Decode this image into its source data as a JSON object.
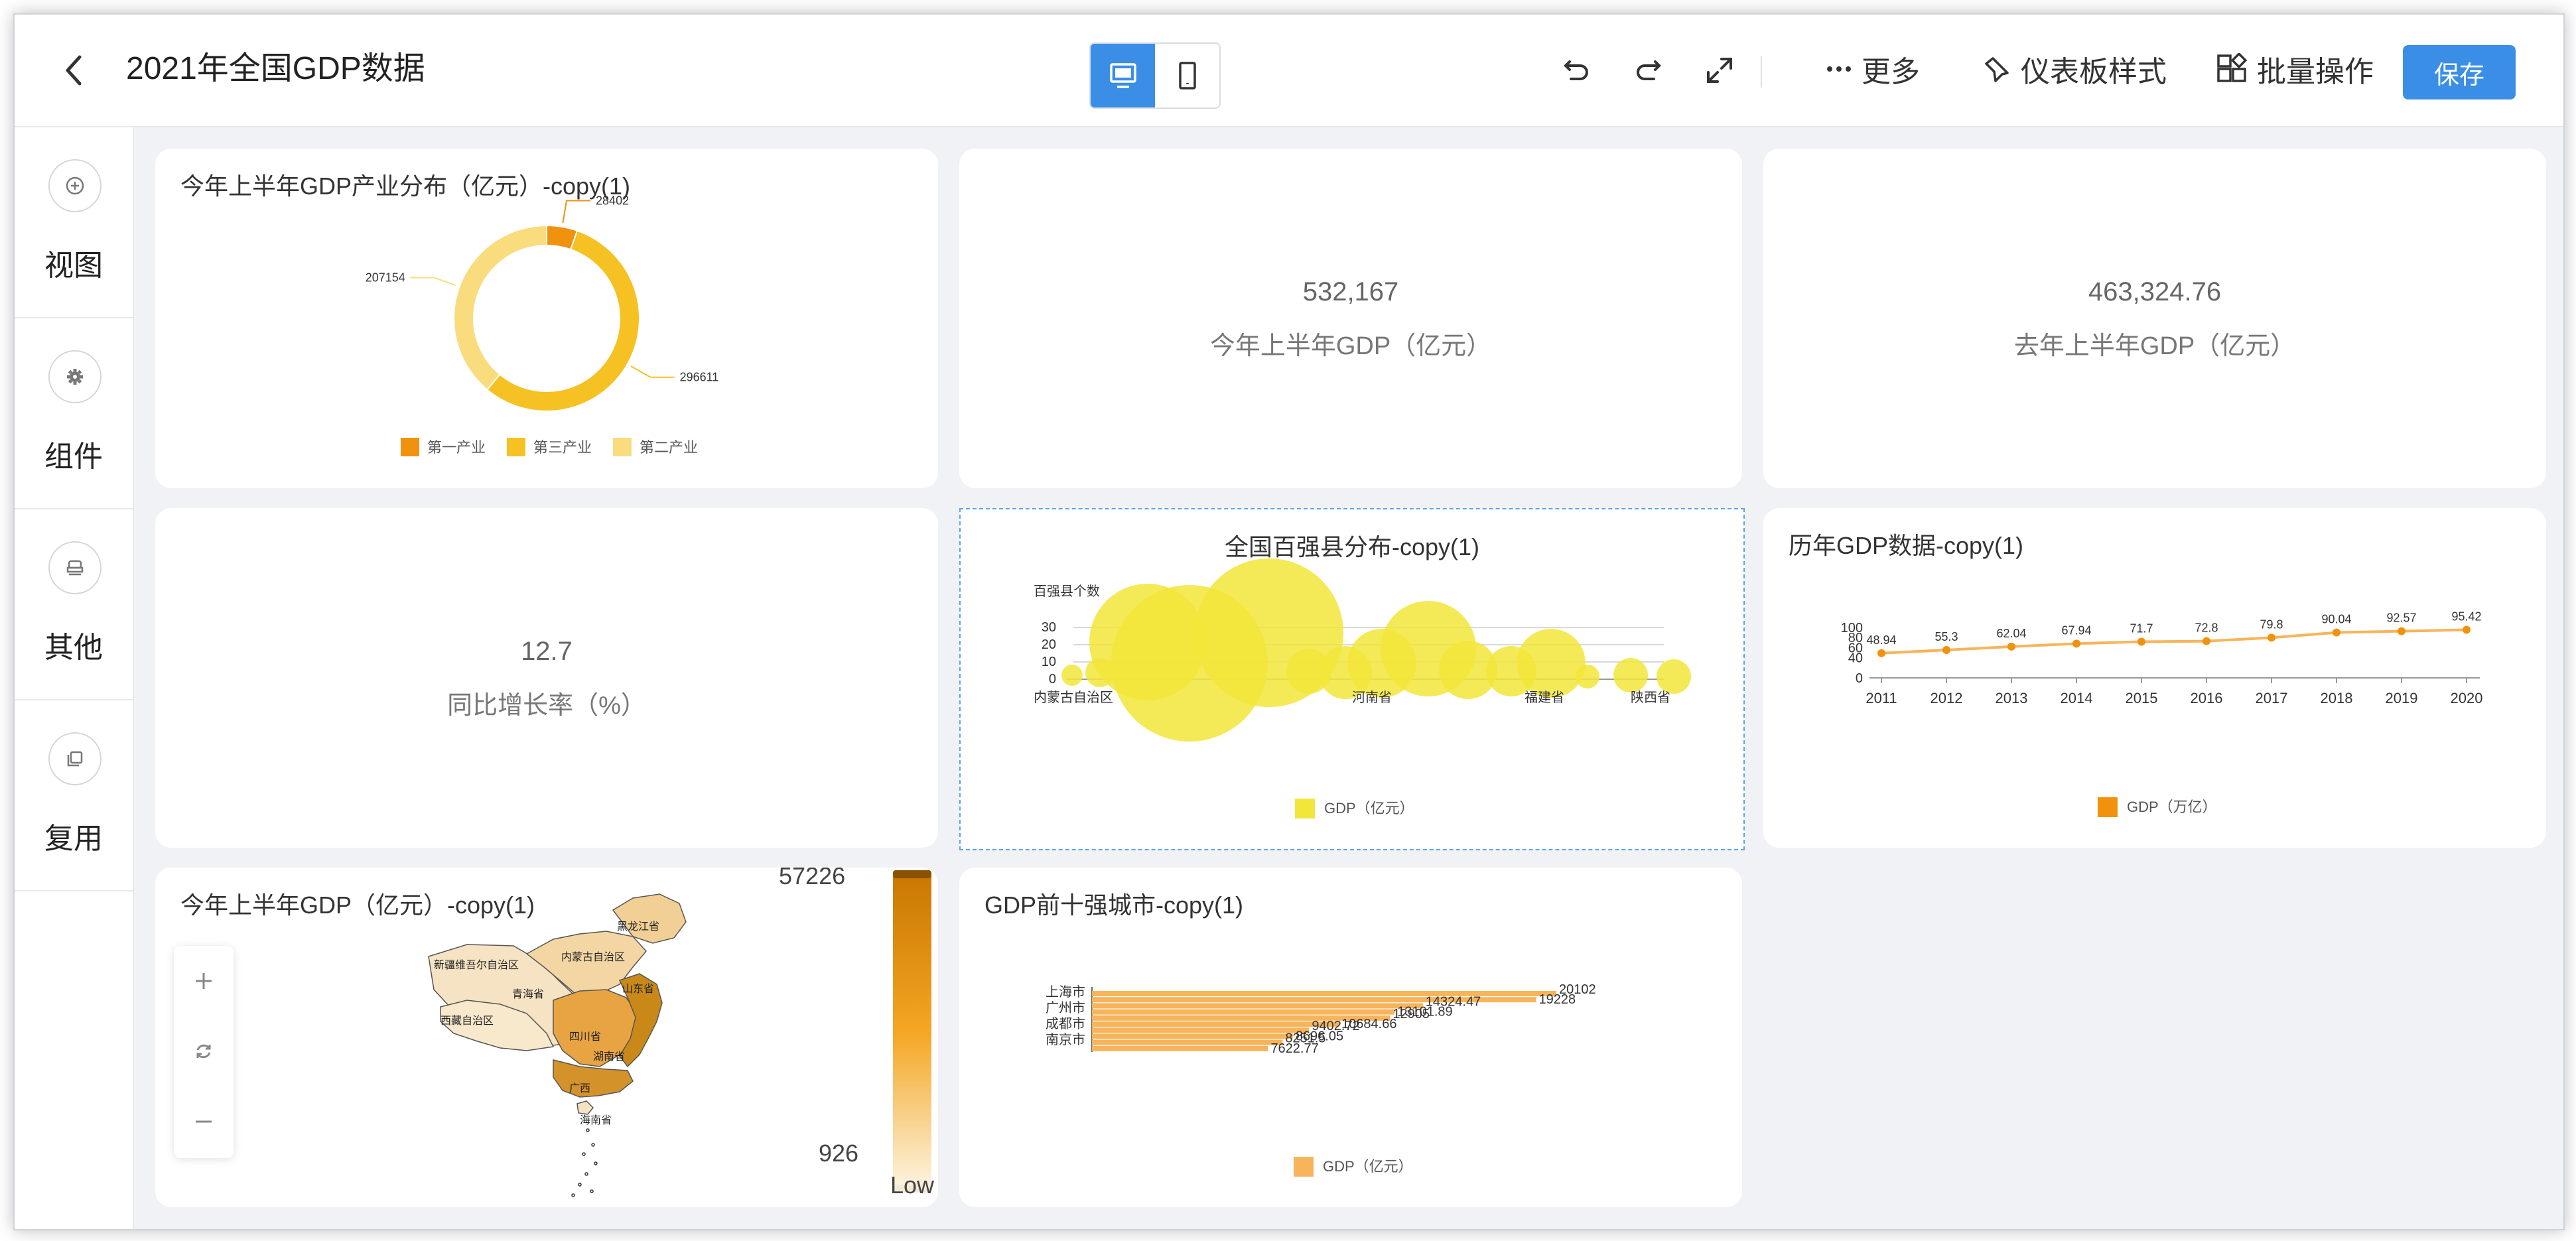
{
  "header": {
    "title": "2021年全国GDP数据",
    "more_label": "更多",
    "style_label": "仪表板样式",
    "batch_label": "批量操作",
    "save_label": "保存"
  },
  "sidebar": {
    "items": [
      {
        "label": "视图",
        "icon": "plus-circle-icon"
      },
      {
        "label": "组件",
        "icon": "gear-icon"
      },
      {
        "label": "其他",
        "icon": "stamp-icon"
      },
      {
        "label": "复用",
        "icon": "copy-icon"
      }
    ]
  },
  "cards": {
    "pie": {
      "title": "今年上半年GDP产业分布（亿元）-copy(1)"
    },
    "kpi1": {
      "value": "532,167",
      "label": "今年上半年GDP（亿元）"
    },
    "kpi2": {
      "value": "463,324.76",
      "label": "去年上半年GDP（亿元）"
    },
    "kpi3": {
      "value": "12.7",
      "label": "同比增长率（%）"
    },
    "bubble": {
      "title": "全国百强县分布-copy(1)"
    },
    "line": {
      "title": "历年GDP数据-copy(1)"
    },
    "map": {
      "title": "今年上半年GDP（亿元）-copy(1)",
      "max": "57226",
      "min": "926",
      "low_label": "Low"
    },
    "bar": {
      "title": "GDP前十强城市-copy(1)"
    }
  },
  "colors": {
    "accent": "#3a8ee6",
    "orange": "#f0920e",
    "yellow": "#f5c123",
    "lightyellow": "#f9dc7e",
    "bubble": "#f2e63a",
    "bar": "#f7b45a"
  },
  "chart_data": [
    {
      "type": "pie",
      "title": "今年上半年GDP产业分布（亿元）-copy(1)",
      "categories": [
        "第一产业",
        "第三产业",
        "第二产业"
      ],
      "values": [
        28402,
        296611,
        207154
      ],
      "colors": [
        "#f0920e",
        "#f5c123",
        "#f9dc7e"
      ],
      "donut": true,
      "legend": "bottom"
    },
    {
      "type": "scatter",
      "title": "全国百强县分布-copy(1)",
      "ylabel": "百强县个数",
      "yticks": [
        0,
        10,
        20,
        30
      ],
      "xlabels": [
        "内蒙古自治区",
        "河南省",
        "福建省",
        "陕西省"
      ],
      "series": [
        {
          "name": "GDP（亿元）"
        }
      ],
      "legend": "bottom"
    },
    {
      "type": "line",
      "title": "历年GDP数据-copy(1)",
      "x": [
        "2011",
        "2012",
        "2013",
        "2014",
        "2015",
        "2016",
        "2017",
        "2018",
        "2019",
        "2020"
      ],
      "series": [
        {
          "name": "GDP（万亿）",
          "values": [
            48.94,
            55.3,
            62.04,
            67.94,
            71.7,
            72.8,
            79.8,
            90.04,
            92.57,
            95.42
          ]
        }
      ],
      "yticks": [
        0,
        40,
        60,
        80,
        100
      ],
      "ylim": [
        0,
        100
      ],
      "legend": "bottom"
    },
    {
      "type": "bar",
      "title": "GDP前十强城市-copy(1)",
      "orientation": "horizontal",
      "category_labels": [
        "上海市",
        "广州市",
        "成都市",
        "南京市"
      ],
      "values": [
        20102,
        19228,
        14324.47,
        13101.89,
        12905,
        10684.66,
        9402.72,
        8696.05,
        8251.5,
        7622.77
      ],
      "value_labels": [
        "20102",
        "19228",
        "14324.47",
        "13101.89",
        "12905",
        "10684.66",
        "9402.72",
        "8696.05",
        "8251.5",
        "7622.77"
      ],
      "series": [
        {
          "name": "GDP（亿元）"
        }
      ],
      "legend": "bottom"
    }
  ]
}
